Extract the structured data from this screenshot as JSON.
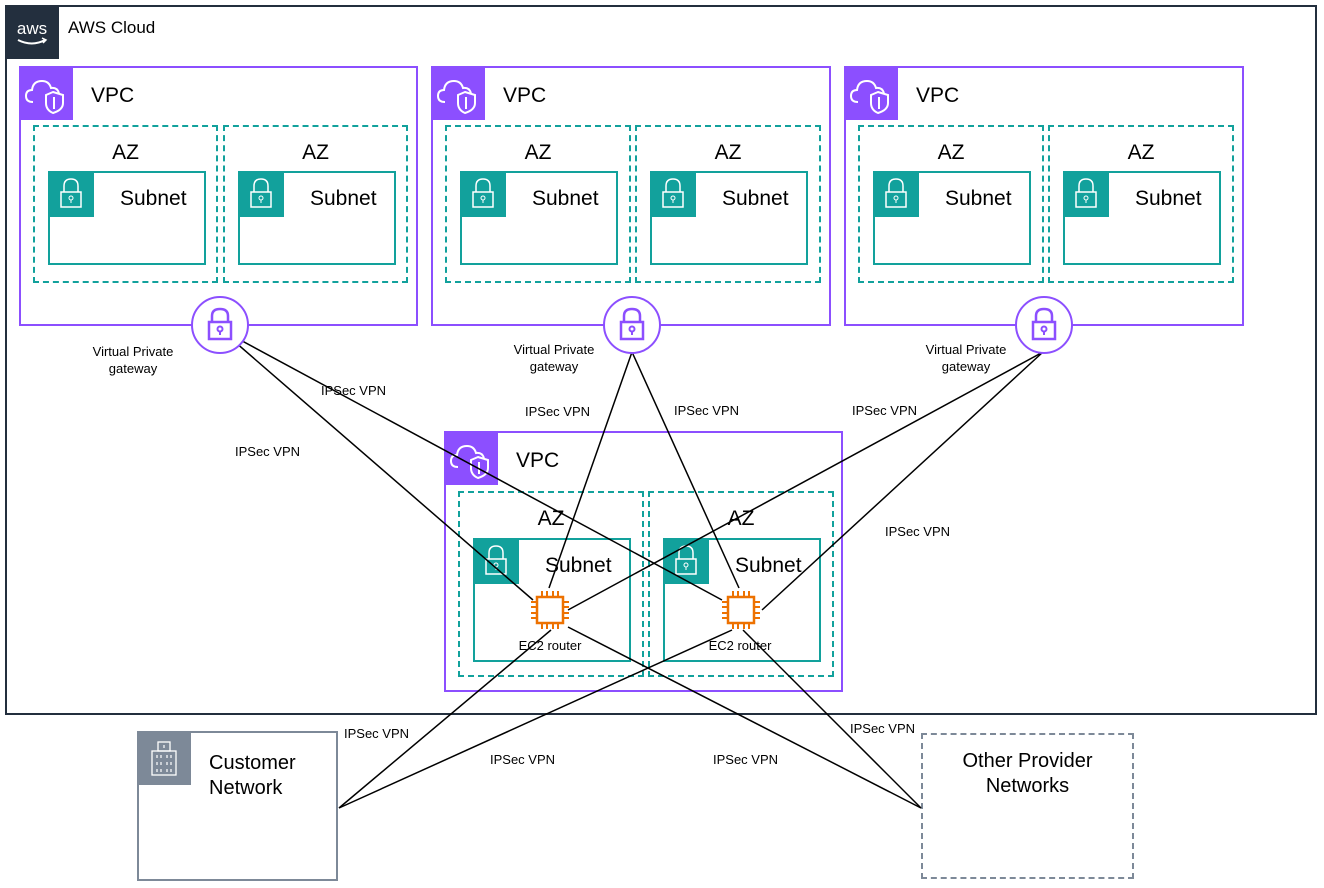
{
  "cloud": {
    "title": "AWS Cloud",
    "logo": "aws-logo-icon"
  },
  "colors": {
    "vpc": "#8c4fff",
    "az": "#12a19c",
    "subnet": "#12a19c",
    "cloud": "#232f3e",
    "network": "#7d8998",
    "router": "#ed7100"
  },
  "vpcs": [
    {
      "title": "VPC",
      "azs": [
        {
          "title": "AZ",
          "subnet": "Subnet"
        },
        {
          "title": "AZ",
          "subnet": "Subnet"
        }
      ],
      "gateway": "Virtual Private gateway"
    },
    {
      "title": "VPC",
      "azs": [
        {
          "title": "AZ",
          "subnet": "Subnet"
        },
        {
          "title": "AZ",
          "subnet": "Subnet"
        }
      ],
      "gateway": "Virtual Private gateway"
    },
    {
      "title": "VPC",
      "azs": [
        {
          "title": "AZ",
          "subnet": "Subnet"
        },
        {
          "title": "AZ",
          "subnet": "Subnet"
        }
      ],
      "gateway": "Virtual Private gateway"
    }
  ],
  "router_vpc": {
    "title": "VPC",
    "azs": [
      {
        "title": "AZ",
        "subnet": "Subnet",
        "router": "EC2 router"
      },
      {
        "title": "AZ",
        "subnet": "Subnet",
        "router": "EC2 router"
      }
    ]
  },
  "customer": {
    "title_line1": "Customer",
    "title_line2": "Network"
  },
  "other": {
    "title_line1": "Other Provider",
    "title_line2": "Networks"
  },
  "connections": [
    {
      "from": "vgw-1",
      "to": "router-1",
      "label": "IPSec VPN"
    },
    {
      "from": "vgw-1",
      "to": "router-2",
      "label": "IPSec VPN"
    },
    {
      "from": "vgw-2",
      "to": "router-1",
      "label": "IPSec VPN"
    },
    {
      "from": "vgw-2",
      "to": "router-2",
      "label": "IPSec VPN"
    },
    {
      "from": "vgw-3",
      "to": "router-1",
      "label": "IPSec VPN"
    },
    {
      "from": "vgw-3",
      "to": "router-2",
      "label": "IPSec VPN"
    },
    {
      "from": "router-1",
      "to": "customer",
      "label": "IPSec VPN"
    },
    {
      "from": "router-2",
      "to": "customer",
      "label": "IPSec VPN"
    },
    {
      "from": "router-1",
      "to": "other",
      "label": "IPSec VPN"
    },
    {
      "from": "router-2",
      "to": "other",
      "label": "IPSec VPN"
    }
  ]
}
